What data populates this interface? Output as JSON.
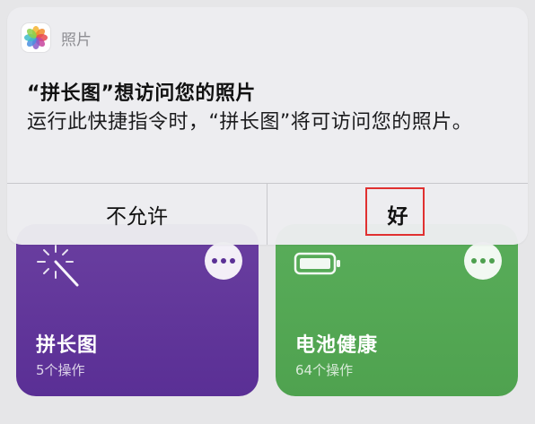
{
  "alert": {
    "app_name": "照片",
    "title": "“拼长图”想访问您的照片",
    "message": "运行此快捷指令时，“拼长图”将可访问您的照片。",
    "buttons": {
      "deny": "不允许",
      "allow": "好"
    },
    "highlight_color": "#e03030"
  },
  "shortcuts": [
    {
      "name": "拼长图",
      "actions": "5个操作",
      "color": "#5e3399",
      "icon": "magic-wand-icon"
    },
    {
      "name": "电池健康",
      "actions": "64个操作",
      "color": "#55a855",
      "icon": "battery-icon"
    }
  ]
}
